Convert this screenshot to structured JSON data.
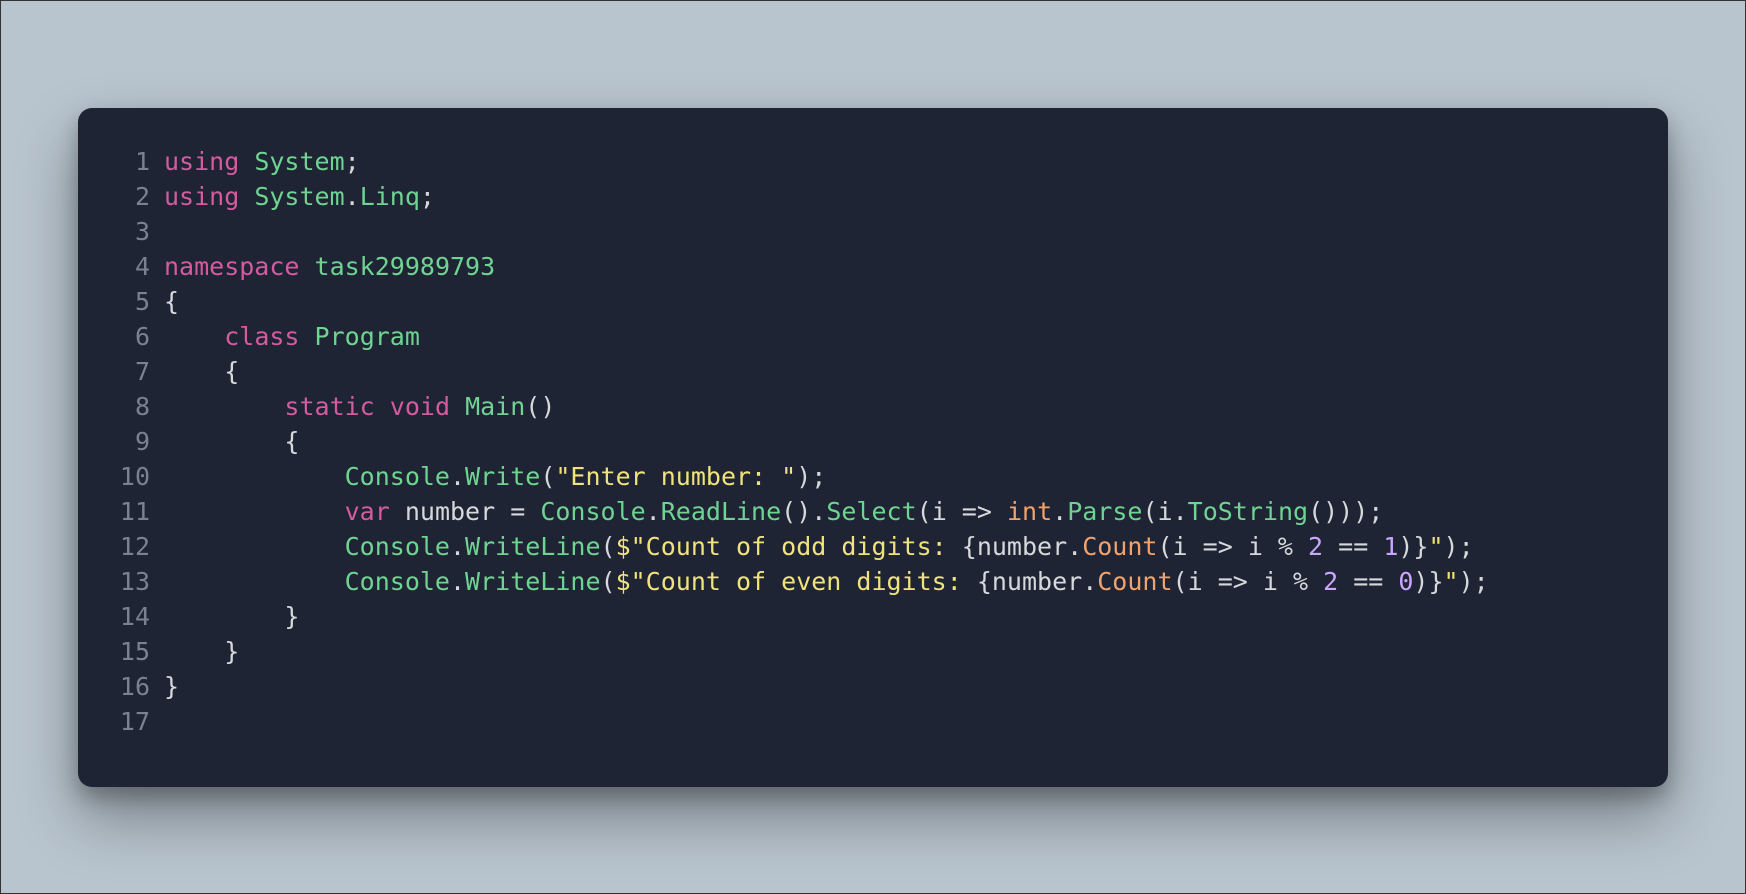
{
  "colors": {
    "background_page": "#b8c4ce",
    "background_editor": "#1e2433",
    "gutter": "#7a8190",
    "default": "#d6d9dc",
    "keyword": "#d35ba0",
    "type": "#6fd492",
    "method": "#6fd492",
    "string": "#f0e27c",
    "orange": "#f2a26b",
    "number": "#caa6ff"
  },
  "lines": [
    {
      "n": "1",
      "tokens": [
        [
          "kw",
          "using"
        ],
        [
          "punc",
          " "
        ],
        [
          "type",
          "System"
        ],
        [
          "punc",
          ";"
        ]
      ]
    },
    {
      "n": "2",
      "tokens": [
        [
          "kw",
          "using"
        ],
        [
          "punc",
          " "
        ],
        [
          "type",
          "System"
        ],
        [
          "punc",
          "."
        ],
        [
          "type",
          "Linq"
        ],
        [
          "punc",
          ";"
        ]
      ]
    },
    {
      "n": "3",
      "tokens": []
    },
    {
      "n": "4",
      "tokens": [
        [
          "kw",
          "namespace"
        ],
        [
          "punc",
          " "
        ],
        [
          "type",
          "task29989793"
        ]
      ]
    },
    {
      "n": "5",
      "tokens": [
        [
          "punc",
          "{"
        ]
      ]
    },
    {
      "n": "6",
      "tokens": [
        [
          "punc",
          "    "
        ],
        [
          "kw",
          "class"
        ],
        [
          "punc",
          " "
        ],
        [
          "type",
          "Program"
        ]
      ]
    },
    {
      "n": "7",
      "tokens": [
        [
          "punc",
          "    {"
        ]
      ]
    },
    {
      "n": "8",
      "tokens": [
        [
          "punc",
          "        "
        ],
        [
          "kw",
          "static"
        ],
        [
          "punc",
          " "
        ],
        [
          "kw",
          "void"
        ],
        [
          "punc",
          " "
        ],
        [
          "fn",
          "Main"
        ],
        [
          "punc",
          "()"
        ]
      ]
    },
    {
      "n": "9",
      "tokens": [
        [
          "punc",
          "        {"
        ]
      ]
    },
    {
      "n": "10",
      "tokens": [
        [
          "punc",
          "            "
        ],
        [
          "type",
          "Console"
        ],
        [
          "punc",
          "."
        ],
        [
          "fn",
          "Write"
        ],
        [
          "punc",
          "("
        ],
        [
          "str",
          "\"Enter number: \""
        ],
        [
          "punc",
          ");"
        ]
      ]
    },
    {
      "n": "11",
      "tokens": [
        [
          "punc",
          "            "
        ],
        [
          "kw",
          "var"
        ],
        [
          "punc",
          " "
        ],
        [
          "param",
          "number"
        ],
        [
          "punc",
          " = "
        ],
        [
          "type",
          "Console"
        ],
        [
          "punc",
          "."
        ],
        [
          "fn",
          "ReadLine"
        ],
        [
          "punc",
          "()."
        ],
        [
          "fn",
          "Select"
        ],
        [
          "punc",
          "("
        ],
        [
          "param",
          "i"
        ],
        [
          "punc",
          " => "
        ],
        [
          "tori",
          "int"
        ],
        [
          "punc",
          "."
        ],
        [
          "fn",
          "Parse"
        ],
        [
          "punc",
          "("
        ],
        [
          "param",
          "i"
        ],
        [
          "punc",
          "."
        ],
        [
          "fn",
          "ToString"
        ],
        [
          "punc",
          "()));"
        ]
      ]
    },
    {
      "n": "12",
      "tokens": [
        [
          "punc",
          "            "
        ],
        [
          "type",
          "Console"
        ],
        [
          "punc",
          "."
        ],
        [
          "fn",
          "WriteLine"
        ],
        [
          "punc",
          "("
        ],
        [
          "str",
          "$\"Count of odd digits: "
        ],
        [
          "punc",
          "{"
        ],
        [
          "param",
          "number"
        ],
        [
          "punc",
          "."
        ],
        [
          "tori",
          "Count"
        ],
        [
          "punc",
          "("
        ],
        [
          "param",
          "i"
        ],
        [
          "punc",
          " => "
        ],
        [
          "param",
          "i"
        ],
        [
          "punc",
          " % "
        ],
        [
          "num",
          "2"
        ],
        [
          "punc",
          " == "
        ],
        [
          "num",
          "1"
        ],
        [
          "punc",
          ")}"
        ],
        [
          "str",
          "\""
        ],
        [
          "punc",
          ");"
        ]
      ]
    },
    {
      "n": "13",
      "tokens": [
        [
          "punc",
          "            "
        ],
        [
          "type",
          "Console"
        ],
        [
          "punc",
          "."
        ],
        [
          "fn",
          "WriteLine"
        ],
        [
          "punc",
          "("
        ],
        [
          "str",
          "$\"Count of even digits: "
        ],
        [
          "punc",
          "{"
        ],
        [
          "param",
          "number"
        ],
        [
          "punc",
          "."
        ],
        [
          "tori",
          "Count"
        ],
        [
          "punc",
          "("
        ],
        [
          "param",
          "i"
        ],
        [
          "punc",
          " => "
        ],
        [
          "param",
          "i"
        ],
        [
          "punc",
          " % "
        ],
        [
          "num",
          "2"
        ],
        [
          "punc",
          " == "
        ],
        [
          "num",
          "0"
        ],
        [
          "punc",
          ")}"
        ],
        [
          "str",
          "\""
        ],
        [
          "punc",
          ");"
        ]
      ]
    },
    {
      "n": "14",
      "tokens": [
        [
          "punc",
          "        }"
        ]
      ]
    },
    {
      "n": "15",
      "tokens": [
        [
          "punc",
          "    }"
        ]
      ]
    },
    {
      "n": "16",
      "tokens": [
        [
          "punc",
          "}"
        ]
      ]
    },
    {
      "n": "17",
      "tokens": []
    }
  ]
}
